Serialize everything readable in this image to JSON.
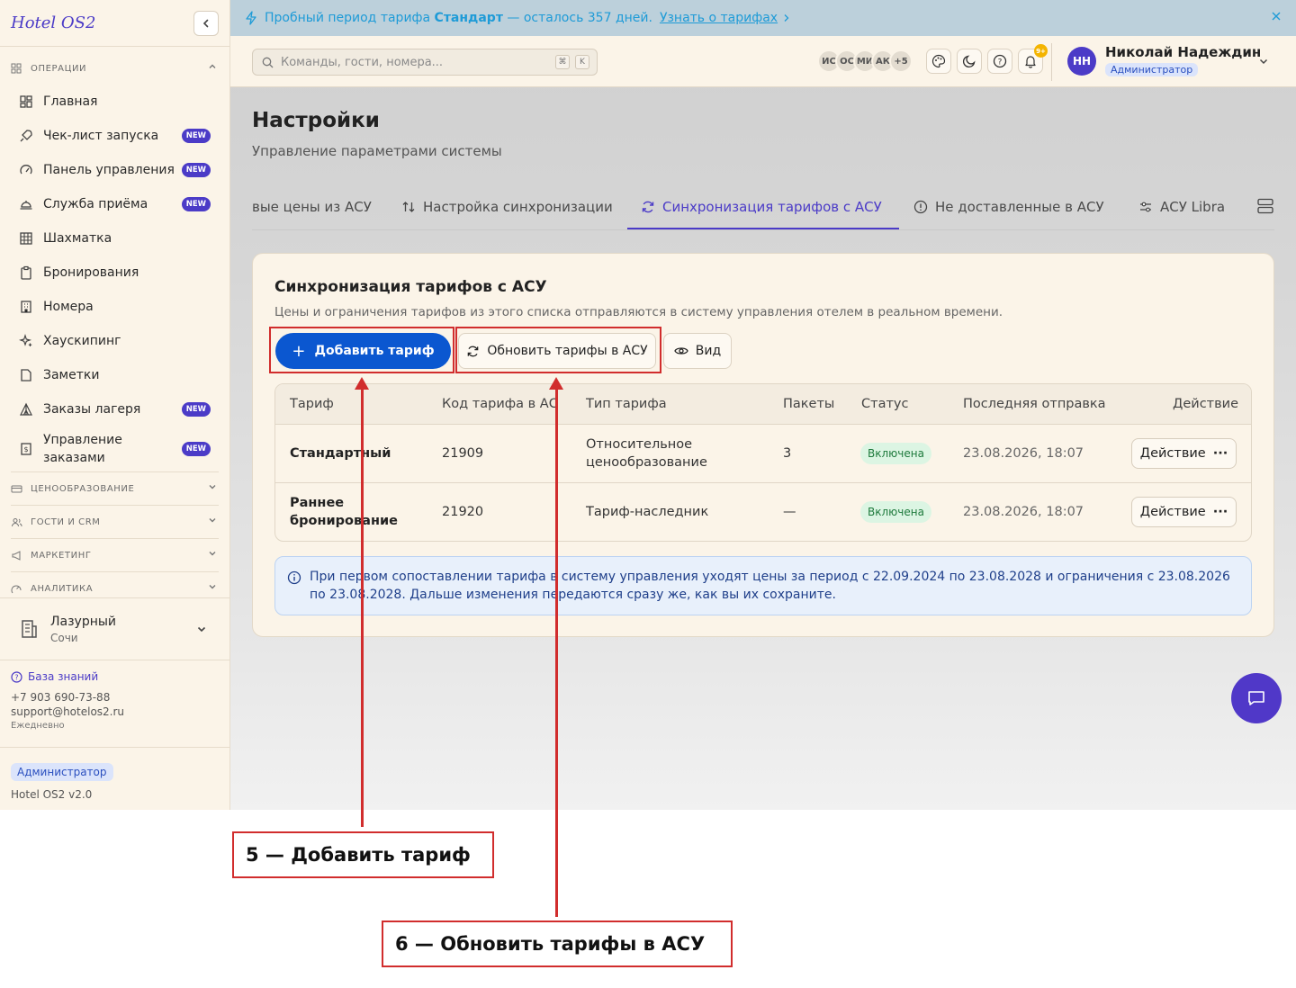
{
  "sidebar": {
    "brand": "Hotel OS2",
    "operations_header": "ОПЕРАЦИИ",
    "items": [
      {
        "label": "Главная",
        "icon": "dashboard-icon",
        "new": false
      },
      {
        "label": "Чек-лист запуска",
        "icon": "rocket-icon",
        "new": true
      },
      {
        "label": "Панель управления",
        "icon": "gauge-icon",
        "new": true
      },
      {
        "label": "Служба приёма",
        "icon": "bell-desk-icon",
        "new": true
      },
      {
        "label": "Шахматка",
        "icon": "grid-icon",
        "new": false
      },
      {
        "label": "Бронирования",
        "icon": "clipboard-icon",
        "new": false
      },
      {
        "label": "Номера",
        "icon": "building-icon",
        "new": false
      },
      {
        "label": "Хаускипинг",
        "icon": "sparkles-icon",
        "new": false
      },
      {
        "label": "Заметки",
        "icon": "note-icon",
        "new": false
      },
      {
        "label": "Заказы лагеря",
        "icon": "tent-icon",
        "new": true
      },
      {
        "label": "Управление заказами",
        "icon": "receipt-icon",
        "new": true
      }
    ],
    "new_badge": "NEW",
    "sections": [
      {
        "label": "ЦЕНООБРАЗОВАНИЕ",
        "icon": "card-icon"
      },
      {
        "label": "ГОСТИ И CRM",
        "icon": "users-icon"
      },
      {
        "label": "МАРКЕТИНГ",
        "icon": "megaphone-icon"
      },
      {
        "label": "АНАЛИТИКА",
        "icon": "chart-icon"
      }
    ],
    "property": {
      "name": "Лазурный",
      "city": "Сочи"
    },
    "support": {
      "kb_label": "База знаний",
      "phone": "+7 903 690-73-88",
      "email": "support@hotelos2.ru",
      "hours": "Ежедневно"
    },
    "role": "Администратор",
    "version": "Hotel OS2 v2.0"
  },
  "trial_banner": {
    "prefix": "Пробный период тарифа",
    "plan": "Стандарт",
    "suffix": "— осталось 357 дней.",
    "link": "Узнать о тарифах"
  },
  "topbar": {
    "search_placeholder": "Команды, гости, номера...",
    "kbd_1": "⌘",
    "kbd_2": "K",
    "avatars": [
      "ИС",
      "ОС",
      "МИ",
      "АК",
      "+5"
    ],
    "notif_count": "9+",
    "user_initials": "НН",
    "user_name": "Николай Надеждин",
    "user_role": "Администратор"
  },
  "page": {
    "title": "Настройки",
    "subtitle": "Управление параметрами системы",
    "tabs": [
      {
        "label": "вые цены из АСУ",
        "active": false
      },
      {
        "label": "Настройка синхронизации",
        "active": false
      },
      {
        "label": "Синхронизация тарифов с АСУ",
        "active": true
      },
      {
        "label": "Не доставленные в АСУ",
        "active": false
      },
      {
        "label": "АСУ Libra",
        "active": false
      }
    ]
  },
  "card": {
    "title": "Синхронизация тарифов с АСУ",
    "subtitle": "Цены и ограничения тарифов из этого списка отправляются в систему управления отелем в реальном времени.",
    "add_button": "Добавить тариф",
    "refresh_button": "Обновить тарифы в АСУ",
    "view_button": "Вид",
    "columns": [
      "Тариф",
      "Код тарифа в АСУ",
      "Тип тарифа",
      "Пакеты",
      "Статус",
      "Последняя отправка",
      "Действие"
    ],
    "rows": [
      {
        "name_1": "Стандартный",
        "name_2": "",
        "code": "21909",
        "type_1": "Относительное",
        "type_2": "ценообразование",
        "packages": "3",
        "status": "Включена",
        "last_sent": "23.08.2026, 18:07",
        "action": "Действие"
      },
      {
        "name_1": "Раннее",
        "name_2": "бронирование",
        "code": "21920",
        "type_1": "Тариф-наследник",
        "type_2": "",
        "packages": "—",
        "status": "Включена",
        "last_sent": "23.08.2026, 18:07",
        "action": "Действие"
      }
    ],
    "info_text": "При первом сопоставлении тарифа в систему управления уходят цены за период с 22.09.2024 по 23.08.2028 и ограничения с 23.08.2026 по 23.08.2028. Дальше изменения передаются сразу же, как вы их сохраните."
  },
  "annotations": {
    "callout_5": "5 — Добавить тариф",
    "callout_6": "6 — Обновить тарифы в АСУ"
  },
  "colors": {
    "accent": "#4b3bc7",
    "primary_button": "#0b57d0",
    "annotation": "#d12d2d",
    "status_ok": "#1e7a3c"
  }
}
